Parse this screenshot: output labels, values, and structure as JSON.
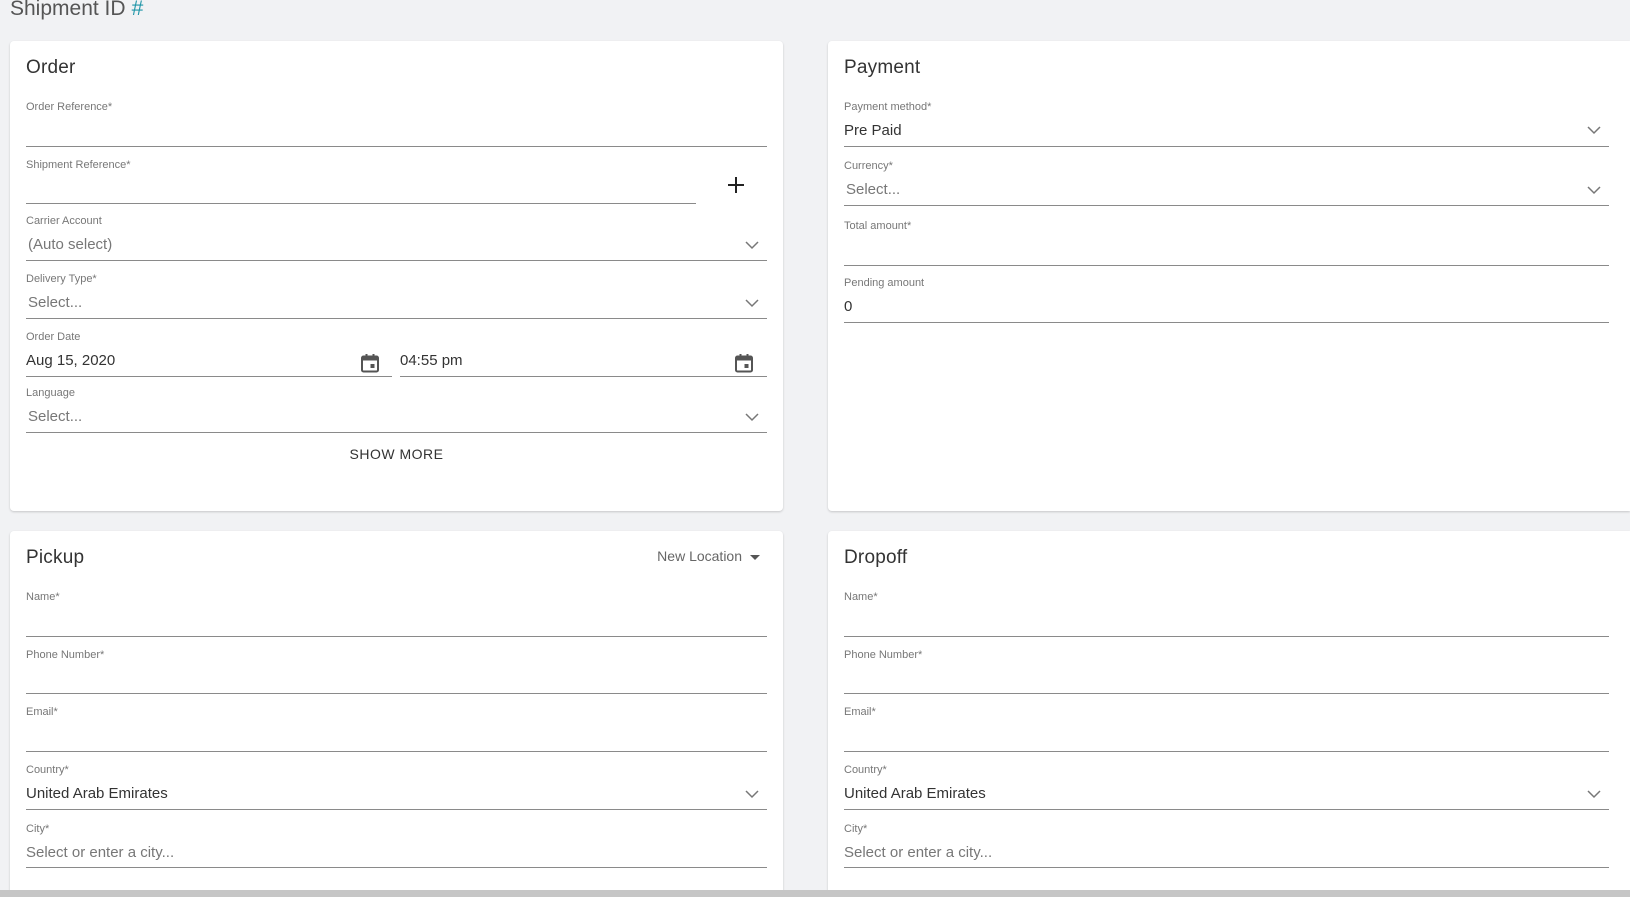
{
  "page": {
    "title": "Shipment ID",
    "hash": "#"
  },
  "order": {
    "title": "Order",
    "order_reference": {
      "label": "Order Reference*",
      "value": ""
    },
    "shipment_reference": {
      "label": "Shipment Reference*",
      "value": ""
    },
    "carrier_account": {
      "label": "Carrier Account",
      "value": "(Auto select)"
    },
    "delivery_type": {
      "label": "Delivery Type*",
      "value": "Select..."
    },
    "order_date": {
      "label": "Order Date",
      "date": "Aug 15, 2020",
      "time": "04:55 pm"
    },
    "language": {
      "label": "Language",
      "value": "Select..."
    },
    "show_more": "SHOW MORE"
  },
  "payment": {
    "title": "Payment",
    "method": {
      "label": "Payment method*",
      "value": "Pre Paid"
    },
    "currency": {
      "label": "Currency*",
      "value": "Select..."
    },
    "total": {
      "label": "Total amount*",
      "value": ""
    },
    "pending": {
      "label": "Pending amount",
      "value": "0"
    }
  },
  "pickup": {
    "title": "Pickup",
    "new_location": "New Location",
    "name": {
      "label": "Name*",
      "value": ""
    },
    "phone": {
      "label": "Phone Number*",
      "value": ""
    },
    "email": {
      "label": "Email*",
      "value": ""
    },
    "country": {
      "label": "Country*",
      "value": "United Arab Emirates"
    },
    "city": {
      "label": "City*",
      "placeholder": "Select or enter a city..."
    }
  },
  "dropoff": {
    "title": "Dropoff",
    "name": {
      "label": "Name*",
      "value": ""
    },
    "phone": {
      "label": "Phone Number*",
      "value": ""
    },
    "email": {
      "label": "Email*",
      "value": ""
    },
    "country": {
      "label": "Country*",
      "value": "United Arab Emirates"
    },
    "city": {
      "label": "City*",
      "placeholder": "Select or enter a city..."
    }
  },
  "icons": {
    "add": "plus-icon",
    "calendar": "calendar-icon",
    "dropdown": "chevron-down-icon",
    "menu_caret": "caret-down-icon"
  },
  "colors": {
    "accent": "#2196a8",
    "background": "#f1f2f4",
    "card": "#ffffff"
  }
}
